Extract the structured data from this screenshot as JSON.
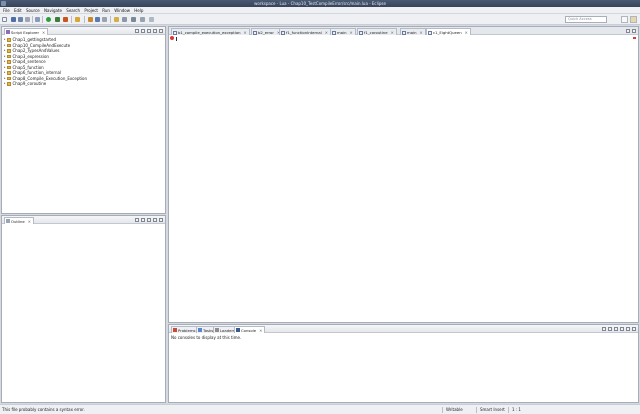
{
  "window": {
    "title": "workspace - Lua - Chap10_TestCompileError/src/main.lua - Eclipse"
  },
  "menu": [
    "File",
    "Edit",
    "Source",
    "Navigate",
    "Search",
    "Project",
    "Run",
    "Window",
    "Help"
  ],
  "toolbar": {
    "quick_access": "Quick Access"
  },
  "script_explorer": {
    "tab_label": "Script Explorer",
    "items": [
      "Chap1_gettingstarted",
      "Chap10_CompileAndExecute",
      "Chap2_TypesAndValues",
      "Chap3_expression",
      "Chap4_sentence",
      "Chap5_function",
      "Chap6_function_internal",
      "Chap8_Compile_Execution_Exception",
      "Chap9_coroutine"
    ]
  },
  "outline": {
    "tab_label": "Outline"
  },
  "editor": {
    "tabs": [
      {
        "label": "b1_compile_execution_exception",
        "active": false
      },
      {
        "label": "b2_error",
        "active": false
      },
      {
        "label": "f1_functionInternal",
        "active": false
      },
      {
        "label": "main",
        "active": false
      },
      {
        "label": "f1_coroutine",
        "active": false
      },
      {
        "label": "main",
        "active": false
      },
      {
        "label": "c1_EightQueen",
        "active": true
      }
    ]
  },
  "console_panel": {
    "tabs": [
      {
        "label": "Problems"
      },
      {
        "label": "Tasks"
      },
      {
        "label": "Loaders"
      },
      {
        "label": "Console"
      }
    ],
    "message": "No consoles to display at this time."
  },
  "statusbar": {
    "message": "This file probably contains a syntax error.",
    "mode": "Writable",
    "insert": "Smart Insert",
    "position": "1 : 1"
  },
  "colors": {
    "accent": "#4a5a73",
    "error_marker": "#d83b3b",
    "folder": "#e3b754"
  }
}
